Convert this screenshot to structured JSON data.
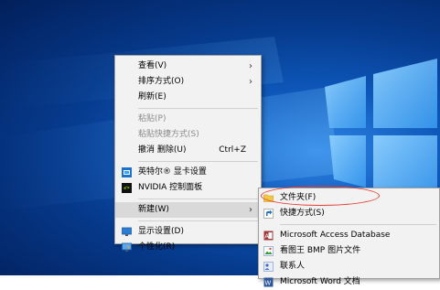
{
  "context_menu": {
    "items": [
      {
        "label": "查看(V)",
        "has_submenu": true
      },
      {
        "label": "排序方式(O)",
        "has_submenu": true
      },
      {
        "label": "刷新(E)"
      },
      {
        "label": "粘贴(P)",
        "disabled": true
      },
      {
        "label": "粘贴快捷方式(S)",
        "disabled": true
      },
      {
        "label": "撤消 删除(U)",
        "shortcut": "Ctrl+Z"
      },
      {
        "label": "英特尔® 显卡设置",
        "icon": "intel-graphics-icon"
      },
      {
        "label": "NVIDIA 控制面板",
        "icon": "nvidia-icon"
      },
      {
        "label": "新建(W)",
        "has_submenu": true,
        "highlighted": true
      },
      {
        "label": "显示设置(D)",
        "icon": "display-settings-icon"
      },
      {
        "label": "个性化(R)",
        "icon": "personalize-icon"
      }
    ]
  },
  "submenu": {
    "items": [
      {
        "label": "文件夹(F)",
        "icon": "folder-icon"
      },
      {
        "label": "快捷方式(S)",
        "icon": "shortcut-icon"
      },
      {
        "label": "Microsoft Access Database",
        "icon": "access-icon"
      },
      {
        "label": "看图王 BMP 图片文件",
        "icon": "bmp-image-icon"
      },
      {
        "label": "联系人",
        "icon": "contact-icon"
      },
      {
        "label": "Microsoft Word 文档",
        "icon": "word-icon"
      }
    ]
  },
  "colors": {
    "annotation_ellipse": "#e63a2f",
    "menu_background": "#f2f2f2",
    "highlight": "#d9d9d9",
    "disabled_text": "#8a8a8a"
  }
}
